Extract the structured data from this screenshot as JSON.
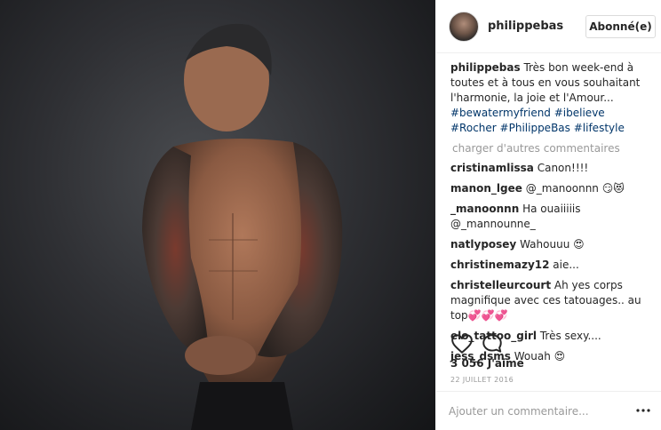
{
  "post": {
    "username": "philippebas",
    "follow_label": "Abonné(e)",
    "caption_user": "philippebas",
    "caption_text": " Très bon week-end à toutes et à tous en vous souhaitant l'harmonie, la joie et l'Amour... ",
    "hashtags": [
      "#bewatermyfriend",
      "#ibelieve",
      "#Rocher",
      "#PhilippeBas",
      "#lifestyle"
    ],
    "load_more": "charger d'autres commentaires",
    "comments": [
      {
        "user": "cristinamlissa",
        "text": "Canon!!!!"
      },
      {
        "user": "manon_lgee",
        "text": "@_manoonnn 😏😻"
      },
      {
        "user": "_manoonnn",
        "text": "Ha ouaiiiiis @_mannounne_"
      },
      {
        "user": "natlyposey",
        "text": "Wahouuu 😍"
      },
      {
        "user": "christinemazy12",
        "text": "aie..."
      },
      {
        "user": "christelleurcourt",
        "text": "Ah yes corps magnifique avec ces tatouages.. au top💞💞💞"
      },
      {
        "user": "elo_tattoo_girl",
        "text": "Très sexy...."
      },
      {
        "user": "jess_dsms",
        "text": "Wouah 😍"
      }
    ],
    "likes": "3 056 J'aime",
    "date": "22 JUILLET 2016",
    "comment_placeholder": "Ajouter un commentaire..."
  },
  "icons": {
    "like": "heart-outline-icon",
    "comment": "speech-bubble-icon",
    "more": "more-dots-icon"
  },
  "colors": {
    "hashtag": "#003569",
    "muted": "#999999",
    "text": "#262626"
  }
}
